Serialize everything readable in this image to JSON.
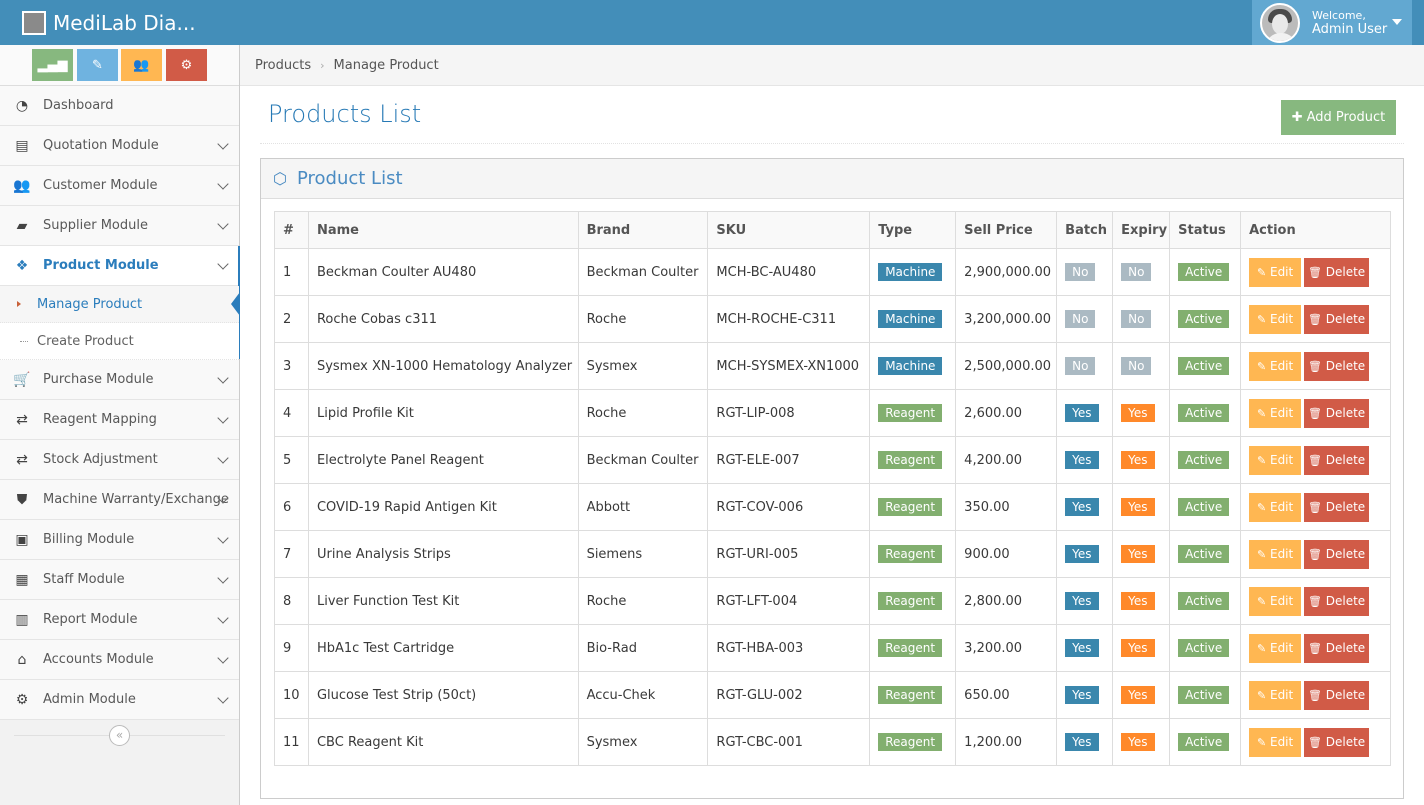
{
  "app": {
    "brand": "MediLab Dia..."
  },
  "user": {
    "welcome": "Welcome,",
    "name": "Admin User"
  },
  "shortcuts": [
    {
      "name": "stats",
      "glyph": "▂▄▆",
      "color": "#87b87f"
    },
    {
      "name": "pencil",
      "glyph": "✎",
      "color": "#6fb3e0"
    },
    {
      "name": "users",
      "glyph": "👥",
      "color": "#ffb752"
    },
    {
      "name": "cogs",
      "glyph": "⚙",
      "color": "#d15b47"
    }
  ],
  "sidebar": {
    "items": [
      {
        "label": "Dashboard",
        "icon": "tachometer-icon",
        "glyph": "◔"
      },
      {
        "label": "Quotation Module",
        "icon": "file-icon",
        "glyph": "▤"
      },
      {
        "label": "Customer Module",
        "icon": "users-icon",
        "glyph": "👥"
      },
      {
        "label": "Supplier Module",
        "icon": "truck-icon",
        "glyph": "▰"
      },
      {
        "label": "Product Module",
        "icon": "cubes-icon",
        "glyph": "❖"
      },
      {
        "label": "Purchase Module",
        "icon": "cart-icon",
        "glyph": "🛒"
      },
      {
        "label": "Reagent Mapping",
        "icon": "exchange-icon",
        "glyph": "⇄"
      },
      {
        "label": "Stock Adjustment",
        "icon": "exchange-icon",
        "glyph": "⇄"
      },
      {
        "label": "Machine Warranty/Exchange",
        "icon": "shield-icon",
        "glyph": "⛊"
      },
      {
        "label": "Billing Module",
        "icon": "money-icon",
        "glyph": "▣"
      },
      {
        "label": "Staff Module",
        "icon": "briefcase-icon",
        "glyph": "▦"
      },
      {
        "label": "Report Module",
        "icon": "bar-chart-icon",
        "glyph": "▥"
      },
      {
        "label": "Accounts Module",
        "icon": "bank-icon",
        "glyph": "⌂"
      },
      {
        "label": "Admin Module",
        "icon": "cogs-icon",
        "glyph": "⚙"
      }
    ],
    "submenu": [
      {
        "label": "Manage Product"
      },
      {
        "label": "Create Product"
      }
    ]
  },
  "breadcrumbs": [
    "Products",
    "Manage Product"
  ],
  "page": {
    "title": "Products List",
    "add_label": "Add Product"
  },
  "widget": {
    "title": "Product List"
  },
  "table": {
    "headers": [
      "#",
      "Name",
      "Brand",
      "SKU",
      "Type",
      "Sell Price",
      "Batch",
      "Expiry",
      "Status",
      "Action"
    ],
    "edit_label": "Edit",
    "delete_label": "Delete",
    "rows": [
      {
        "num": "1",
        "name": "Beckman Coulter AU480",
        "brand": "Beckman Coulter",
        "sku": "MCH-BC-AU480",
        "type": "Machine",
        "price": "2,900,000.00",
        "batch": "No",
        "expiry": "No",
        "status": "Active"
      },
      {
        "num": "2",
        "name": "Roche Cobas c311",
        "brand": "Roche",
        "sku": "MCH-ROCHE-C311",
        "type": "Machine",
        "price": "3,200,000.00",
        "batch": "No",
        "expiry": "No",
        "status": "Active"
      },
      {
        "num": "3",
        "name": "Sysmex XN-1000 Hematology Analyzer",
        "brand": "Sysmex",
        "sku": "MCH-SYSMEX-XN1000",
        "type": "Machine",
        "price": "2,500,000.00",
        "batch": "No",
        "expiry": "No",
        "status": "Active"
      },
      {
        "num": "4",
        "name": "Lipid Profile Kit",
        "brand": "Roche",
        "sku": "RGT-LIP-008",
        "type": "Reagent",
        "price": "2,600.00",
        "batch": "Yes",
        "expiry": "Yes",
        "status": "Active"
      },
      {
        "num": "5",
        "name": "Electrolyte Panel Reagent",
        "brand": "Beckman Coulter",
        "sku": "RGT-ELE-007",
        "type": "Reagent",
        "price": "4,200.00",
        "batch": "Yes",
        "expiry": "Yes",
        "status": "Active"
      },
      {
        "num": "6",
        "name": "COVID-19 Rapid Antigen Kit",
        "brand": "Abbott",
        "sku": "RGT-COV-006",
        "type": "Reagent",
        "price": "350.00",
        "batch": "Yes",
        "expiry": "Yes",
        "status": "Active"
      },
      {
        "num": "7",
        "name": "Urine Analysis Strips",
        "brand": "Siemens",
        "sku": "RGT-URI-005",
        "type": "Reagent",
        "price": "900.00",
        "batch": "Yes",
        "expiry": "Yes",
        "status": "Active"
      },
      {
        "num": "8",
        "name": "Liver Function Test Kit",
        "brand": "Roche",
        "sku": "RGT-LFT-004",
        "type": "Reagent",
        "price": "2,800.00",
        "batch": "Yes",
        "expiry": "Yes",
        "status": "Active"
      },
      {
        "num": "9",
        "name": "HbA1c Test Cartridge",
        "brand": "Bio-Rad",
        "sku": "RGT-HBA-003",
        "type": "Reagent",
        "price": "3,200.00",
        "batch": "Yes",
        "expiry": "Yes",
        "status": "Active"
      },
      {
        "num": "10",
        "name": "Glucose Test Strip (50ct)",
        "brand": "Accu-Chek",
        "sku": "RGT-GLU-002",
        "type": "Reagent",
        "price": "650.00",
        "batch": "Yes",
        "expiry": "Yes",
        "status": "Active"
      },
      {
        "num": "11",
        "name": "CBC Reagent Kit",
        "brand": "Sysmex",
        "sku": "RGT-CBC-001",
        "type": "Reagent",
        "price": "1,200.00",
        "batch": "Yes",
        "expiry": "Yes",
        "status": "Active"
      }
    ]
  }
}
